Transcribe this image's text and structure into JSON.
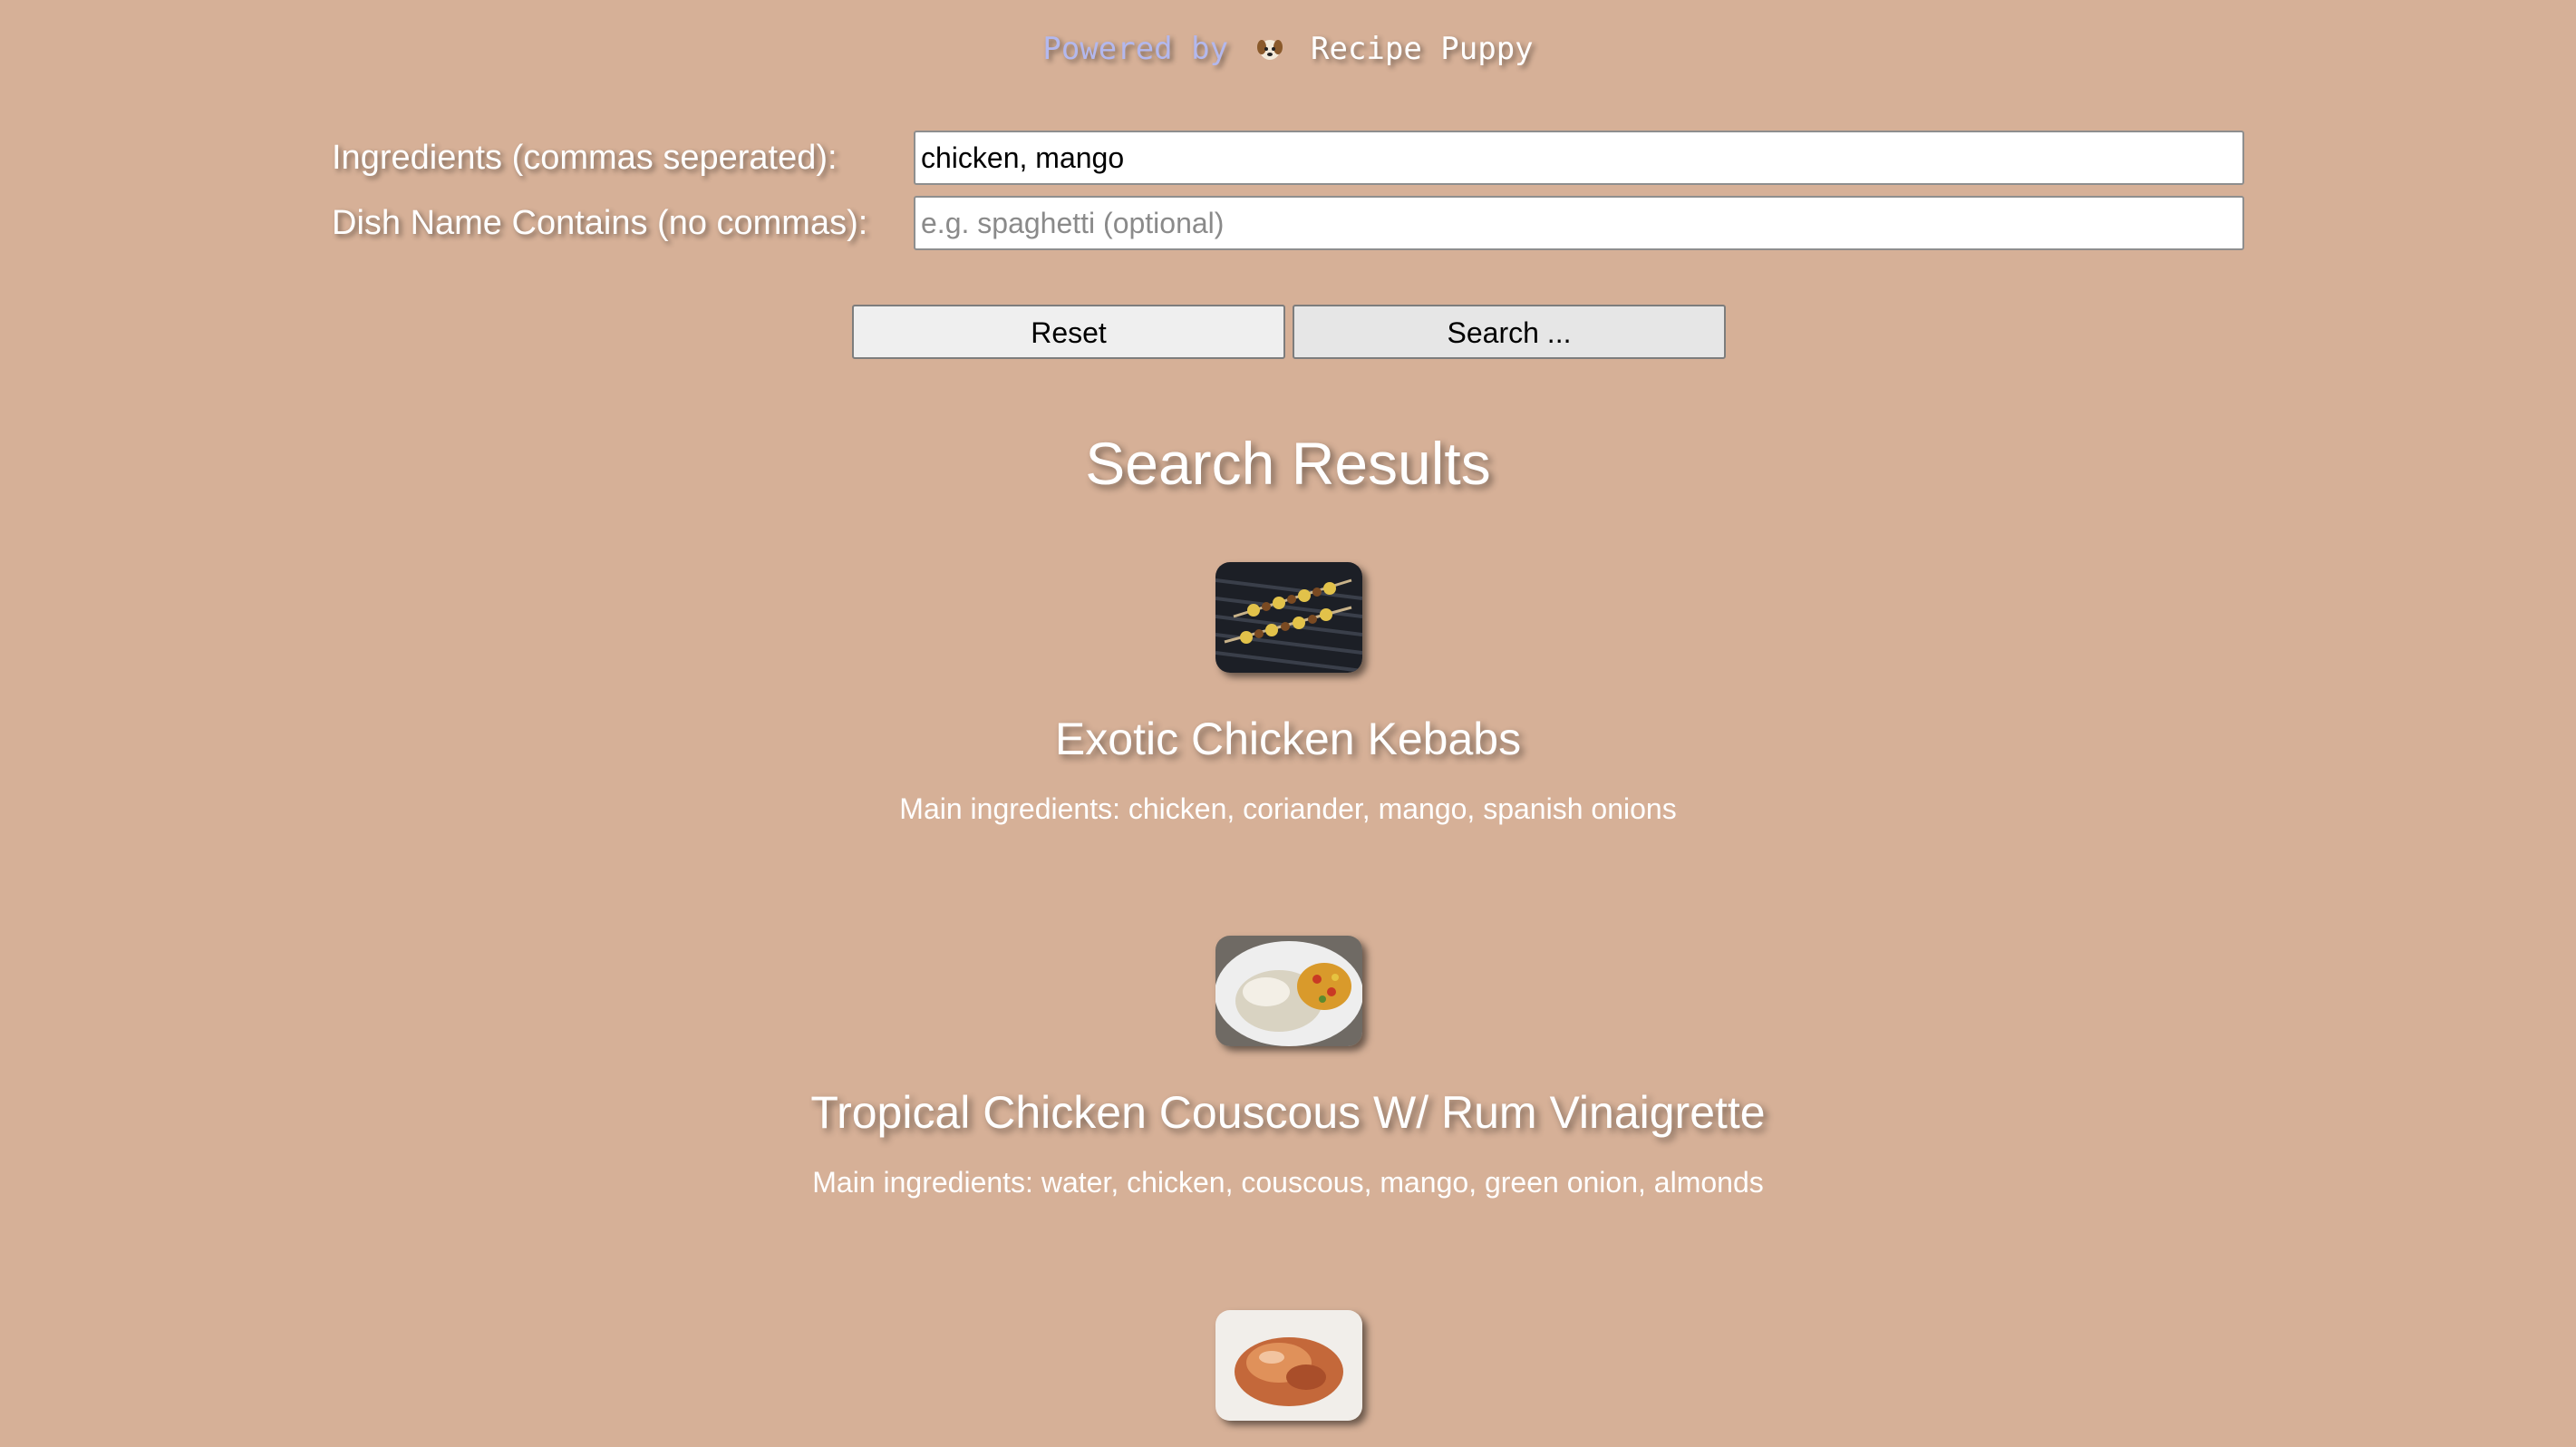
{
  "header": {
    "powered_prefix": "Powered by",
    "brand": "Recipe Puppy",
    "logo_icon": "puppy-face-icon"
  },
  "form": {
    "ingredients_label": "Ingredients (commas seperated):",
    "ingredients_value": "chicken, mango",
    "dish_label": "Dish Name Contains (no commas):",
    "dish_value": "",
    "dish_placeholder": "e.g. spaghetti (optional)"
  },
  "buttons": {
    "reset_label": "Reset",
    "search_label": "Search ..."
  },
  "results": {
    "heading": "Search Results",
    "items": [
      {
        "title": "Exotic Chicken Kebabs",
        "ingredients": "Main ingredients: chicken, coriander, mango, spanish onions",
        "thumbnail": "grilled-kebabs-photo"
      },
      {
        "title": "Tropical Chicken Couscous W/ Rum Vinaigrette",
        "ingredients": "Main ingredients: water, chicken, couscous, mango, green onion, almonds",
        "thumbnail": "chicken-couscous-plate-photo"
      },
      {
        "title": "",
        "ingredients": "",
        "thumbnail": "roast-chicken-plate-photo"
      }
    ]
  },
  "colors": {
    "background": "#d6b097",
    "text": "#ffffff",
    "powered_prefix": "#b3b8ee"
  }
}
